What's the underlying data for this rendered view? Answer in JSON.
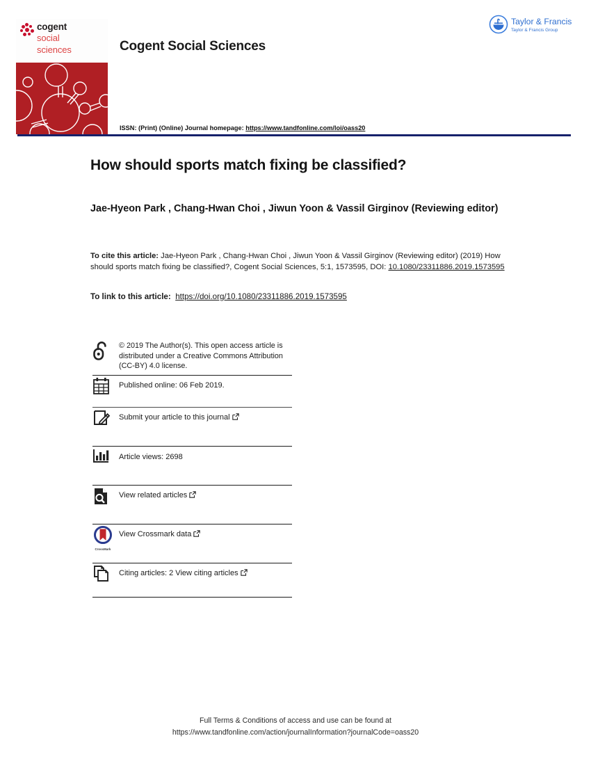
{
  "masthead": {
    "cover": {
      "logo_word": "cogent",
      "logo_sub_line1": "social",
      "logo_sub_line2": "sciences",
      "cover_bg_color": "#b01f24",
      "logo_accent_color": "#c8102e"
    },
    "journal_title": "Cogent Social Sciences",
    "publisher_logo": {
      "name": "Taylor & Francis",
      "tagline": "Taylor & Francis Group",
      "color": "#3b7ddd"
    },
    "issn_prefix": "ISSN: (Print) (Online) Journal homepage: ",
    "issn_url": "https://www.tandfonline.com/loi/oass20",
    "rule_color": "#16216b"
  },
  "article": {
    "title": "How should sports match fixing be classified?",
    "authors": "Jae-Hyeon Park , Chang-Hwan Choi , Jiwun Yoon & Vassil Girginov (Reviewing editor)",
    "cite_label": "To cite this article:",
    "cite_text": " Jae-Hyeon Park , Chang-Hwan Choi , Jiwun Yoon & Vassil Girginov (Reviewing editor) (2019) How should sports match fixing be classified?, Cogent Social Sciences, 5:1, 1573595, DOI: ",
    "cite_doi": "10.1080/23311886.2019.1573595",
    "link_label": "To link to this article:",
    "link_url": "https://doi.org/10.1080/23311886.2019.1573595"
  },
  "rows": {
    "open_access": {
      "icon": "open-access-unlock-icon",
      "text": "© 2019 The Author(s). This open access article is distributed under a Creative Commons Attribution (CC-BY) 4.0 license."
    },
    "published": {
      "icon": "calendar-icon",
      "text": "Published online: 06 Feb 2019."
    },
    "submit": {
      "icon": "pencil-square-icon",
      "text": "Submit your article to this journal",
      "external": "external-link-icon"
    },
    "views": {
      "icon": "bar-chart-icon",
      "text": "Article views: 2698",
      "count": 2698
    },
    "related": {
      "icon": "document-search-icon",
      "text": "View related articles",
      "external": "external-link-icon"
    },
    "crossmark": {
      "icon": "crossmark-icon",
      "icon_label": "CrossMark",
      "text": "View Crossmark data",
      "external": "external-link-icon"
    },
    "citing": {
      "icon": "stacked-documents-icon",
      "text": "Citing articles: 2 View citing articles",
      "count": 2,
      "external": "external-link-icon"
    }
  },
  "footer": {
    "line1": "Full Terms & Conditions of access and use can be found at",
    "line2": "https://www.tandfonline.com/action/journalInformation?journalCode=oass20"
  }
}
